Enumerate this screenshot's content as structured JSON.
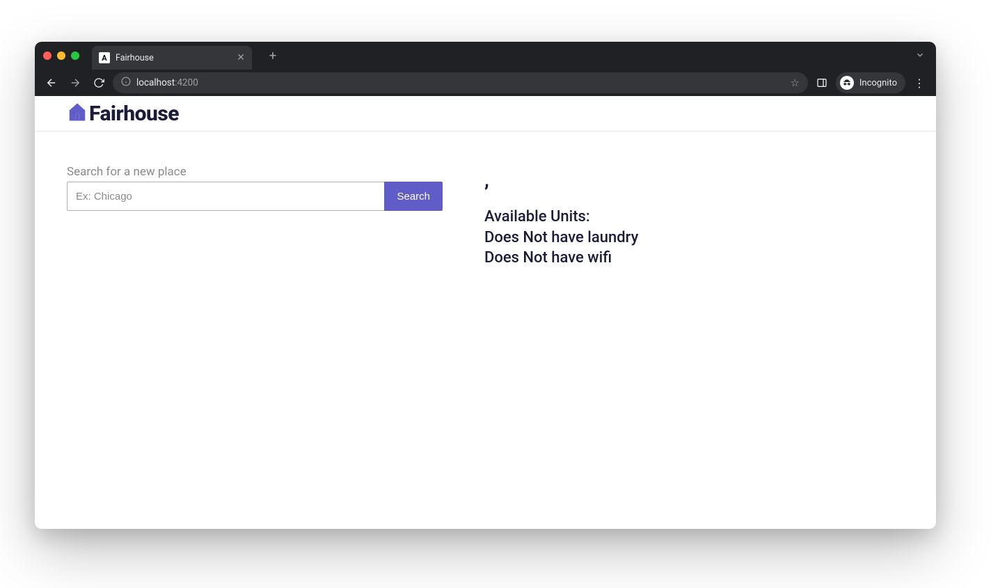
{
  "browser": {
    "tab_title": "Fairhouse",
    "favicon_letter": "A",
    "url_host": "localhost",
    "url_port": ":4200",
    "incognito_label": "Incognito"
  },
  "header": {
    "brand": "Fairhouse"
  },
  "search": {
    "label": "Search for a new place",
    "placeholder": "Ex: Chicago",
    "button": "Search",
    "value": ""
  },
  "details": {
    "title_suffix": ",",
    "units_label": "Available Units:",
    "laundry_line": "Does Not have laundry",
    "wifi_line": "Does Not have wifi"
  }
}
